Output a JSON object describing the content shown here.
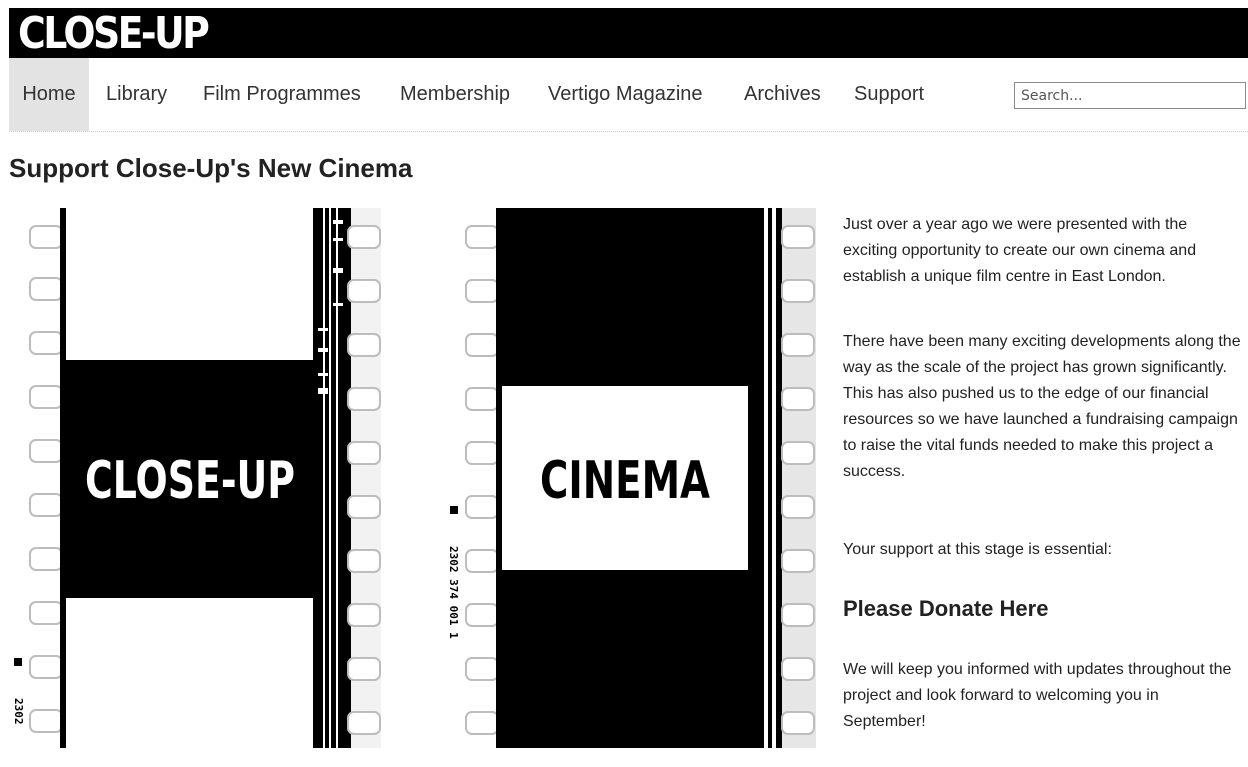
{
  "header": {
    "logo": "CLOSE-UP"
  },
  "nav": {
    "items": [
      {
        "label": "Home"
      },
      {
        "label": "Library"
      },
      {
        "label": "Film Programmes"
      },
      {
        "label": "Membership"
      },
      {
        "label": "Vertigo Magazine"
      },
      {
        "label": "Archives"
      },
      {
        "label": "Support"
      }
    ],
    "search_placeholder": "Search..."
  },
  "main": {
    "title": "Support Close-Up's New Cinema",
    "image": {
      "left_frame_text": "CLOSE-UP",
      "right_frame_text": "CINEMA",
      "edge_code_left": "2302",
      "edge_code_right": "2302  374  001  1"
    },
    "paragraphs": [
      "Just over a year ago we were presented with the exciting opportunity to create our own cinema and establish a unique film centre in East London.",
      "There have been many exciting developments along the way as the scale of the project has grown significantly. This has also pushed us to the edge of our financial resources so we have launched a fundraising campaign to raise the vital funds needed to make this project a success.",
      "Your support at this stage is essential:"
    ],
    "donate_label": "Please Donate Here",
    "closing": "We will keep you informed with updates throughout the project and look forward to welcoming you in September!"
  },
  "colors": {
    "header_bg": "#000000",
    "nav_active_bg": "#e3e3e3",
    "text": "#222222"
  }
}
